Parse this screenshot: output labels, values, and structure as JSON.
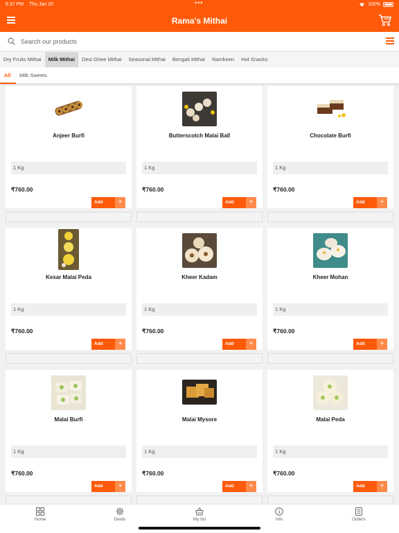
{
  "status_bar": {
    "time": "6:37 PM",
    "date": "Thu Jan 20",
    "battery": "100%"
  },
  "header": {
    "title": "Rama's Mithai"
  },
  "search": {
    "placeholder": "Search our products",
    "value": ""
  },
  "categories": [
    {
      "label": "Dry Fruits Mithai",
      "active": false
    },
    {
      "label": "Milk Mithai",
      "active": true
    },
    {
      "label": "Desi Ghee Mithai",
      "active": false
    },
    {
      "label": "Seasonal Mithai",
      "active": false
    },
    {
      "label": "Bengali Mithai",
      "active": false
    },
    {
      "label": "Namkeen",
      "active": false
    },
    {
      "label": "Hot Snacks",
      "active": false
    }
  ],
  "subtabs": [
    {
      "label": "All",
      "active": true
    },
    {
      "label": "Milk Sweets",
      "active": false
    }
  ],
  "products": [
    {
      "name": "Anjeer Burfi",
      "weight": "1 Kg",
      "price": "₹760.00",
      "add_label": "Add",
      "plus": "+",
      "image_icon": "anjeer-burfi-image"
    },
    {
      "name": "Butterscotch Malai Ball",
      "weight": "1 Kg",
      "price": "₹760.00",
      "add_label": "Add",
      "plus": "+",
      "image_icon": "butterscotch-malai-ball-image"
    },
    {
      "name": "Chocolate Burfi",
      "weight": "1 Kg",
      "price": "₹760.00",
      "add_label": "Add",
      "plus": "+",
      "image_icon": "chocolate-burfi-image"
    },
    {
      "name": "Kesar Malai Peda",
      "weight": "1 Kg",
      "price": "₹760.00",
      "add_label": "Add",
      "plus": "+",
      "image_icon": "kesar-malai-peda-image"
    },
    {
      "name": "Kheer Kadam",
      "weight": "1 Kg",
      "price": "₹760.00",
      "add_label": "Add",
      "plus": "+",
      "image_icon": "kheer-kadam-image"
    },
    {
      "name": "Kheer Mohan",
      "weight": "1 Kg",
      "price": "₹760.00",
      "add_label": "Add",
      "plus": "+",
      "image_icon": "kheer-mohan-image"
    },
    {
      "name": "Malai Burfi",
      "weight": "1 Kg",
      "price": "₹760.00",
      "add_label": "Add",
      "plus": "+",
      "image_icon": "malai-burfi-image"
    },
    {
      "name": "Malai Mysore",
      "weight": "1 Kg",
      "price": "₹760.00",
      "add_label": "Add",
      "plus": "+",
      "image_icon": "malai-mysore-image"
    },
    {
      "name": "Malai Peda",
      "weight": "1 Kg",
      "price": "₹760.00",
      "add_label": "Add",
      "plus": "+",
      "image_icon": "malai-peda-image"
    }
  ],
  "bottom_nav": [
    {
      "label": "Home",
      "icon": "grid-icon"
    },
    {
      "label": "Deals",
      "icon": "gear-icon"
    },
    {
      "label": "My list",
      "icon": "basket-icon"
    },
    {
      "label": "Info",
      "icon": "info-icon"
    },
    {
      "label": "Orders",
      "icon": "orders-icon"
    }
  ],
  "colors": {
    "brand": "#ff5a0a",
    "brand_light": "#ff8a4a",
    "background": "#f1f1f1"
  }
}
